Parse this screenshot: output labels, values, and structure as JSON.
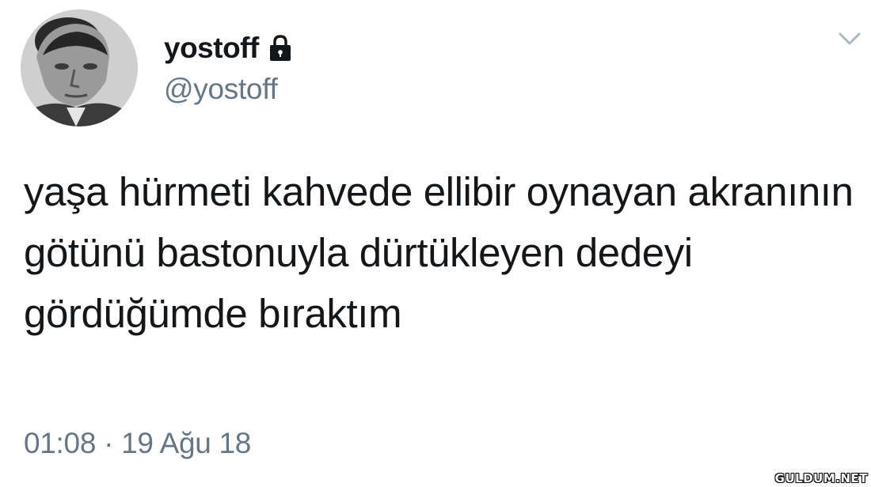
{
  "user": {
    "display_name": "yostoff",
    "handle": "@yostoff",
    "protected_icon": "lock-icon",
    "avatar_icon": "avatar-photo"
  },
  "menu": {
    "icon": "chevron-down-icon"
  },
  "tweet": {
    "text": "yaşa hürmeti kahvede ellibir oynayan akranının götünü bastonuyla dürtükleyen dedeyi gördüğümde bıraktım",
    "timestamp": "01:08 · 19 Ağu 18"
  },
  "watermark": "GULDUM.NET",
  "colors": {
    "text_primary": "#14171a",
    "text_secondary": "#657786",
    "background": "#ffffff"
  }
}
